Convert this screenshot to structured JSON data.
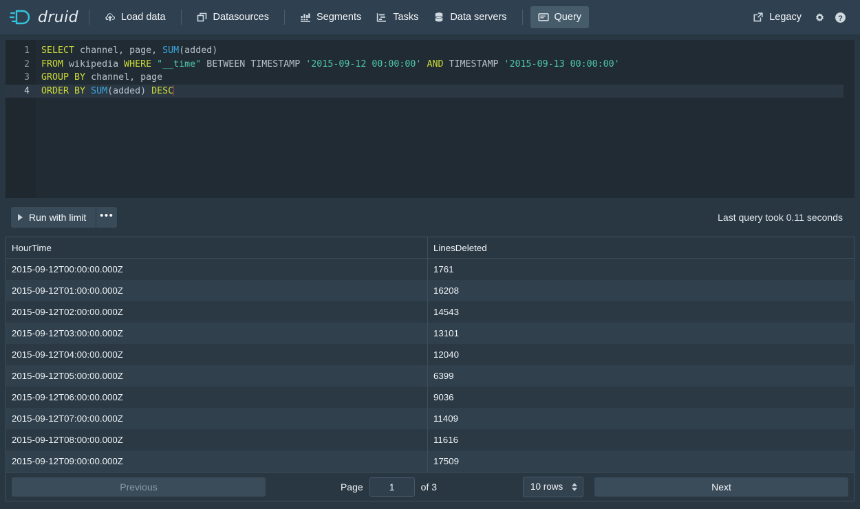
{
  "navbar": {
    "brand": {
      "name": "druid-logo",
      "text": "druid"
    },
    "items": [
      {
        "id": "load-data",
        "label": "Load data",
        "icon": "cloud-upload-icon",
        "active": false
      },
      {
        "id": "datasources",
        "label": "Datasources",
        "icon": "multi-select-icon",
        "active": false
      },
      {
        "id": "segments",
        "label": "Segments",
        "icon": "stacked-chart-icon",
        "active": false
      },
      {
        "id": "tasks",
        "label": "Tasks",
        "icon": "gantt-chart-icon",
        "active": false
      },
      {
        "id": "data-servers",
        "label": "Data servers",
        "icon": "database-icon",
        "active": false
      },
      {
        "id": "query",
        "label": "Query",
        "icon": "application-icon",
        "active": true
      }
    ],
    "right": {
      "legacy_label": "Legacy",
      "legacy_icon": "share-external-icon",
      "settings_icon": "gear-icon",
      "help_icon": "help-circle-icon"
    }
  },
  "editor": {
    "line_numbers": [
      "1",
      "2",
      "3",
      "4"
    ],
    "active_line": 4,
    "lines": [
      [
        {
          "t": "SELECT",
          "c": "kw"
        },
        {
          "t": " channel, page, ",
          "c": "plain"
        },
        {
          "t": "SUM",
          "c": "fn"
        },
        {
          "t": "(added)",
          "c": "plain"
        }
      ],
      [
        {
          "t": "FROM",
          "c": "kw"
        },
        {
          "t": " wikipedia ",
          "c": "plain"
        },
        {
          "t": "WHERE",
          "c": "kw"
        },
        {
          "t": " ",
          "c": "plain"
        },
        {
          "t": "\"__time\"",
          "c": "ident"
        },
        {
          "t": " BETWEEN TIMESTAMP ",
          "c": "plain"
        },
        {
          "t": "'2015-09-12 00:00:00'",
          "c": "str"
        },
        {
          "t": " ",
          "c": "plain"
        },
        {
          "t": "AND",
          "c": "kw"
        },
        {
          "t": " TIMESTAMP ",
          "c": "plain"
        },
        {
          "t": "'2015-09-13 00:00:00'",
          "c": "str"
        }
      ],
      [
        {
          "t": "GROUP",
          "c": "kw"
        },
        {
          "t": " ",
          "c": "plain"
        },
        {
          "t": "BY",
          "c": "kw"
        },
        {
          "t": " channel, page",
          "c": "plain"
        }
      ],
      [
        {
          "t": "ORDER",
          "c": "kw"
        },
        {
          "t": " ",
          "c": "plain"
        },
        {
          "t": "BY",
          "c": "kw"
        },
        {
          "t": " ",
          "c": "plain"
        },
        {
          "t": "SUM",
          "c": "fn"
        },
        {
          "t": "(added) ",
          "c": "plain"
        },
        {
          "t": "DESC",
          "c": "kw"
        }
      ]
    ],
    "raw_sql": "SELECT channel, page, SUM(added)\nFROM wikipedia WHERE \"__time\" BETWEEN TIMESTAMP '2015-09-12 00:00:00' AND TIMESTAMP '2015-09-13 00:00:00'\nGROUP BY channel, page\nORDER BY SUM(added) DESC"
  },
  "toolbar": {
    "run_label": "Run with limit",
    "run_icon": "play-icon",
    "more_label": "•••",
    "timing_label": "Last query took 0.11 seconds"
  },
  "results": {
    "columns": [
      "HourTime",
      "LinesDeleted"
    ],
    "rows": [
      [
        "2015-09-12T00:00:00.000Z",
        "1761"
      ],
      [
        "2015-09-12T01:00:00.000Z",
        "16208"
      ],
      [
        "2015-09-12T02:00:00.000Z",
        "14543"
      ],
      [
        "2015-09-12T03:00:00.000Z",
        "13101"
      ],
      [
        "2015-09-12T04:00:00.000Z",
        "12040"
      ],
      [
        "2015-09-12T05:00:00.000Z",
        "6399"
      ],
      [
        "2015-09-12T06:00:00.000Z",
        "9036"
      ],
      [
        "2015-09-12T07:00:00.000Z",
        "11409"
      ],
      [
        "2015-09-12T08:00:00.000Z",
        "11616"
      ],
      [
        "2015-09-12T09:00:00.000Z",
        "17509"
      ]
    ]
  },
  "pagination": {
    "previous_label": "Previous",
    "next_label": "Next",
    "page_label": "Page",
    "page_value": "1",
    "of_label": "of 3",
    "rows_value": "10 rows"
  },
  "colors": {
    "page_bg": "#293742",
    "navbar_bg": "#2f4050",
    "editor_bg": "#212b33",
    "accent": "#41c9e0",
    "button_bg": "#394b59",
    "row_odd": "#2b3945",
    "row_even": "#30404d",
    "border": "#3d4f5d"
  }
}
